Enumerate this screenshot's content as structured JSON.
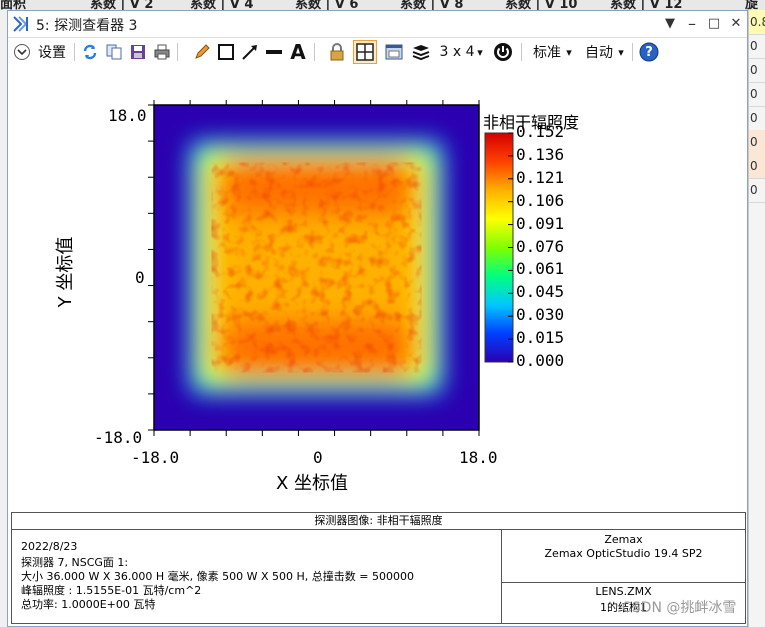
{
  "background_sheet": {
    "header_cells": [
      "面积",
      "系数 | V 2",
      "系数 | V 4",
      "系数 | V 6",
      "系数 | V 8",
      "系数 | V 10",
      "系数 | V 12",
      "旋"
    ],
    "right_cells": [
      "0.8",
      "0",
      "0",
      "0",
      "0",
      "0",
      "0",
      "0"
    ]
  },
  "window": {
    "title": "5: 探测查看器 3",
    "controls": {
      "dropdown": "▼",
      "pin": "📌",
      "minimize": "–",
      "maximize": "□",
      "close": "✕"
    }
  },
  "toolbar": {
    "settings_label": "设置",
    "layout_label": "3 x 4",
    "layout_arrow": "▾",
    "standard_label": "标准",
    "standard_arrow": "▾",
    "auto_label": "自动",
    "auto_arrow": "▾",
    "text_tool_glyph": "A",
    "help_glyph": "?"
  },
  "chart_data": {
    "type": "heatmap",
    "title": "",
    "xlabel": "X 坐标值",
    "ylabel": "Y 坐标值",
    "xlim": [
      -18.0,
      18.0
    ],
    "ylim": [
      -18.0,
      18.0
    ],
    "x_ticks": [
      "-18.0",
      "0",
      "18.0"
    ],
    "y_ticks": [
      "18.0",
      "0",
      "-18.0"
    ],
    "colorbar": {
      "label": "非相干辐照度",
      "min": 0.0,
      "max": 0.152,
      "ticks": [
        "0.152",
        "0.136",
        "0.121",
        "0.106",
        "0.091",
        "0.076",
        "0.061",
        "0.045",
        "0.030",
        "0.015",
        "0.000"
      ],
      "colors": [
        "#2b00b0",
        "#0040ff",
        "#00c8ff",
        "#00ff80",
        "#80ff00",
        "#ffff00",
        "#ffb000",
        "#ff4000",
        "#d40000"
      ]
    },
    "description_values": {
      "uniform_region_x": [
        -12.5,
        12.5
      ],
      "uniform_region_y": [
        -12.5,
        12.5
      ],
      "peak": 0.152,
      "band_rows_y": [
        9.0,
        -9.0
      ]
    }
  },
  "info": {
    "header": "探测器图像: 非相干辐照度",
    "date": "2022/8/23",
    "line1": "探测器 7, NSCG面 1:",
    "line2": "大小 36.000 W X 36.000 H 毫米, 像素 500 W X 500 H, 总撞击数 = 500000",
    "line3": "峰辐照度 : 1.5155E-01 瓦特/cm^2",
    "line4": "总功率: 1.0000E+00 瓦特",
    "vendor": "Zemax",
    "product": "Zemax OpticStudio 19.4 SP2",
    "file": "LENS.ZMX",
    "config": "1的结构1"
  },
  "watermark": "CSDN @挑衅冰雪"
}
